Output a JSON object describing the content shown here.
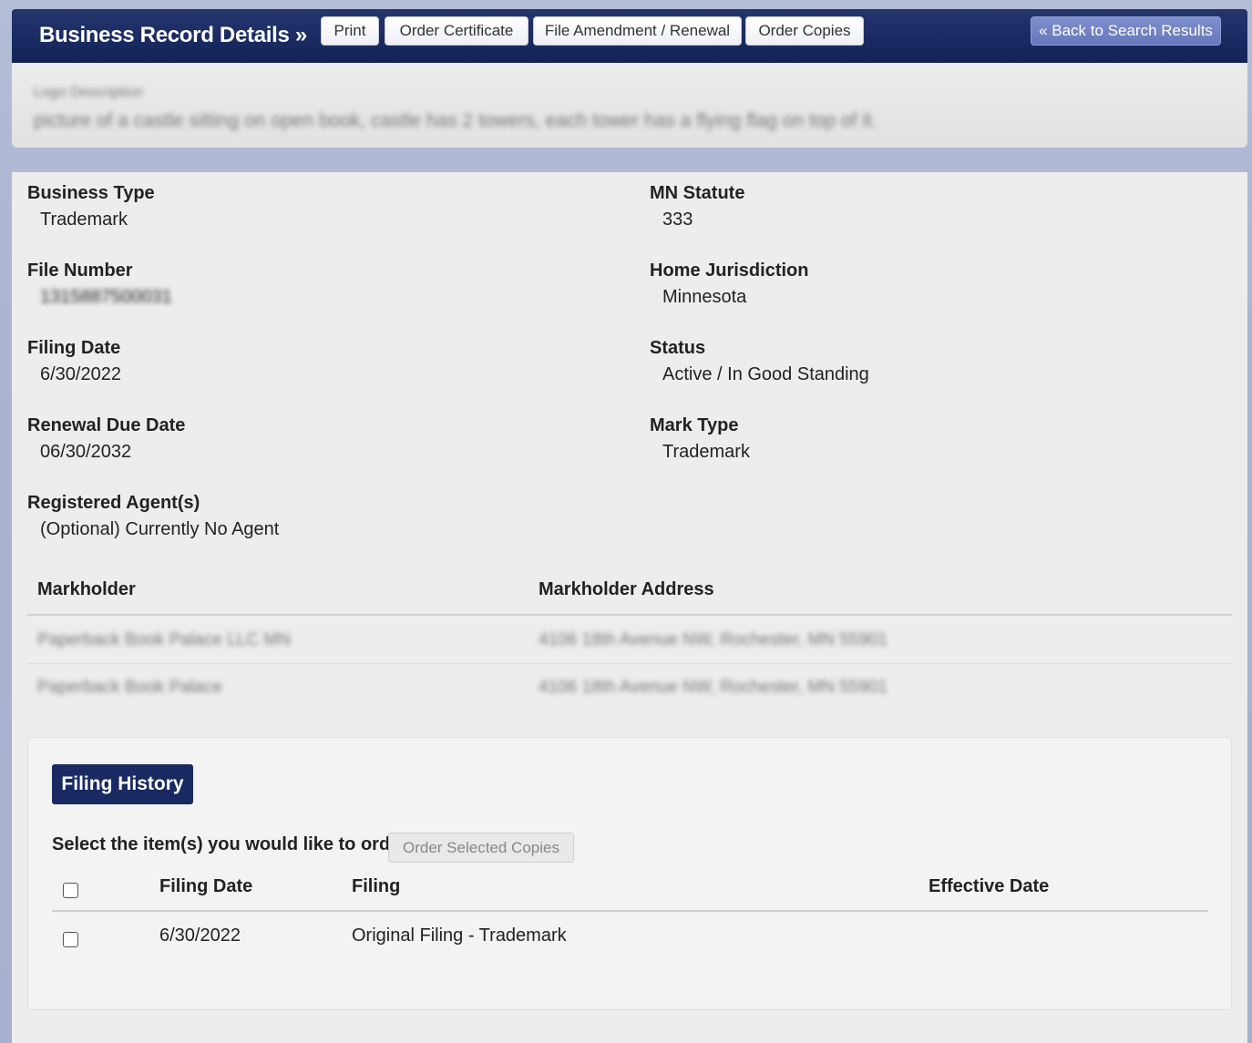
{
  "header": {
    "title": "Business Record Details »",
    "buttons": {
      "print": "Print",
      "order_certificate": "Order Certificate",
      "file_amendment": "File Amendment / Renewal",
      "order_copies": "Order Copies",
      "back": "« Back to Search Results"
    }
  },
  "logo": {
    "label": "Logo Description",
    "description": "picture of a castle sitting on open book, castle has 2 towers, each tower has a flying flag on top of it."
  },
  "fields": {
    "business_type": {
      "label": "Business Type",
      "value": "Trademark"
    },
    "mn_statute": {
      "label": "MN Statute",
      "value": "333"
    },
    "file_number": {
      "label": "File Number",
      "value": "1315887500031"
    },
    "home_jurisdiction": {
      "label": "Home Jurisdiction",
      "value": "Minnesota"
    },
    "filing_date": {
      "label": "Filing Date",
      "value": "6/30/2022"
    },
    "status": {
      "label": "Status",
      "value": "Active / In Good Standing"
    },
    "renewal_due_date": {
      "label": "Renewal Due Date",
      "value": "06/30/2032"
    },
    "mark_type": {
      "label": "Mark Type",
      "value": "Trademark"
    },
    "registered_agent": {
      "label": "Registered Agent(s)",
      "value": "(Optional) Currently No Agent"
    }
  },
  "markholders": {
    "headers": {
      "name": "Markholder",
      "address": "Markholder Address"
    },
    "rows": [
      {
        "name": "Paperback Book Palace LLC MN",
        "address": "4106 18th Avenue NW, Rochester, MN 55901"
      },
      {
        "name": "Paperback Book Palace",
        "address": "4106 18th Avenue NW, Rochester, MN 55901"
      }
    ]
  },
  "filing_history": {
    "tab_label": "Filing History",
    "select_prompt": "Select the item(s) you would like to order:",
    "order_button": "Order Selected Copies",
    "columns": {
      "filing_date": "Filing Date",
      "filing": "Filing",
      "effective_date": "Effective Date"
    },
    "rows": [
      {
        "filing_date": "6/30/2022",
        "filing": "Original Filing - Trademark",
        "effective_date": ""
      }
    ]
  }
}
